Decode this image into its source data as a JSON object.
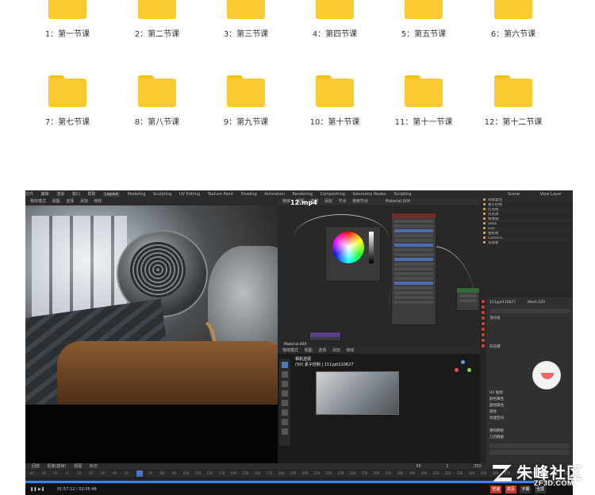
{
  "folders": [
    {
      "label": "1：第一节课"
    },
    {
      "label": "2：第二节课"
    },
    {
      "label": "3：第三节课"
    },
    {
      "label": "4：第四节课"
    },
    {
      "label": "5：第五节课"
    },
    {
      "label": "6：第六节课"
    },
    {
      "label": "7：第七节课"
    },
    {
      "label": "8：第八节课"
    },
    {
      "label": "9：第九节课"
    },
    {
      "label": "10：第十节课"
    },
    {
      "label": "11：第十一节课"
    },
    {
      "label": "12：第十二节课"
    }
  ],
  "folder_color": "#f9cb30",
  "video": {
    "file_title": "12.mp4",
    "topbar": {
      "menus": [
        "文件",
        "编辑",
        "渲染",
        "窗口",
        "帮助"
      ],
      "workspaces": [
        "Layout",
        "Modeling",
        "Sculpting",
        "UV Editing",
        "Texture Paint",
        "Shading",
        "Animation",
        "Rendering",
        "Compositing",
        "Geometry Nodes",
        "Scripting"
      ],
      "active_workspace": "Layout",
      "scene": "Scene",
      "view_layer": "View Layer"
    },
    "viewport_header": [
      "物体模式",
      "视图",
      "选择",
      "添加",
      "物体"
    ],
    "node_header": [
      "物体",
      "视图",
      "选择",
      "添加",
      "节点",
      "使用节点"
    ],
    "node_material": "Material.004",
    "node_label": "Material.004",
    "preview_header": [
      "物体模式",
      "视图",
      "选择",
      "添加",
      "物体"
    ],
    "preview_info": [
      "相机透视",
      "(50) 素子控制 | 111ypt110627"
    ],
    "outliner": {
      "title": "场景集合",
      "rows": [
        "场景集合",
        "素子控制",
        "灯光组",
        "点光源",
        "物体组",
        "Stool",
        "Sun",
        "相机组",
        "Camera",
        "背景板"
      ]
    },
    "properties": {
      "object_name": "111ypt110627",
      "mesh_name": "Mesh.320",
      "sections": [
        "顶点组",
        "形态键",
        "UV 贴图",
        "颜色属性",
        "面拐属性",
        "属性",
        "纹理空间",
        "重构网格",
        "几何数据"
      ]
    },
    "timeline": {
      "menus": [
        "回放",
        "抠像(插帧)",
        "视图",
        "标记"
      ],
      "ticks": [
        "-30",
        "-20",
        "-10",
        "0",
        "10",
        "20",
        "30",
        "40",
        "50",
        "60",
        "70",
        "80",
        "90",
        "100",
        "110",
        "120",
        "130",
        "140",
        "150",
        "160",
        "170",
        "180",
        "190",
        "200",
        "210",
        "220",
        "230",
        "240",
        "250",
        "260",
        "270",
        "280",
        "290",
        "300",
        "310",
        "320",
        "330",
        "340",
        "350",
        "360",
        "370",
        "380",
        "390",
        "400",
        "410",
        "420",
        "430",
        "440",
        "450",
        "460"
      ],
      "current_frame": "50",
      "start": "1",
      "end": "250"
    },
    "player": {
      "time": "01:57:12 / 02:05:48",
      "progress": 0.93,
      "buttons": [
        "倍速",
        "高清",
        "字幕",
        "全屏"
      ]
    }
  },
  "watermark": {
    "text": "朱峰社区",
    "sub": "ZF3D.COM"
  }
}
